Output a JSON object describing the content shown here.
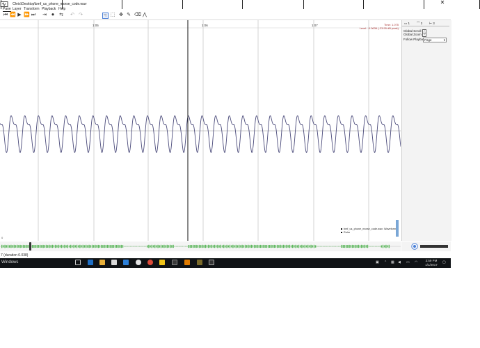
{
  "window": {
    "title": "Chris\\Desktop\\bmf_us_phone_morse_code.wav"
  },
  "menu": {
    "items": [
      "Pane",
      "Layer",
      "Transform",
      "Playback",
      "Help"
    ]
  },
  "ruler": {
    "labels": [
      "1:05",
      "1:06",
      "1:07"
    ]
  },
  "readout": {
    "time": "Time: 1.075",
    "level": "Level: -0.0636 (-23.95 dB peak)"
  },
  "right_panel": {
    "tabs": [
      "1",
      "2",
      "3"
    ],
    "global_scroll": "Global Scroll",
    "global_zoom": "Global Zoom",
    "follow_playback": "Follow Playback",
    "follow_value": "Page"
  },
  "legend": {
    "items": [
      "bmf_us_phone_morse_code.wav: Waveform",
      "Ruler"
    ]
  },
  "status": {
    "text": "7 (duration 0.038)"
  },
  "taskbar": {
    "start_label": "Windows",
    "time": "3:59 PM",
    "date": "1/1/2017"
  },
  "colors": {
    "waveform": "#4a4a7a",
    "overview": "#5cb85c",
    "playhead": "#111111",
    "taskbar": "#101316"
  }
}
